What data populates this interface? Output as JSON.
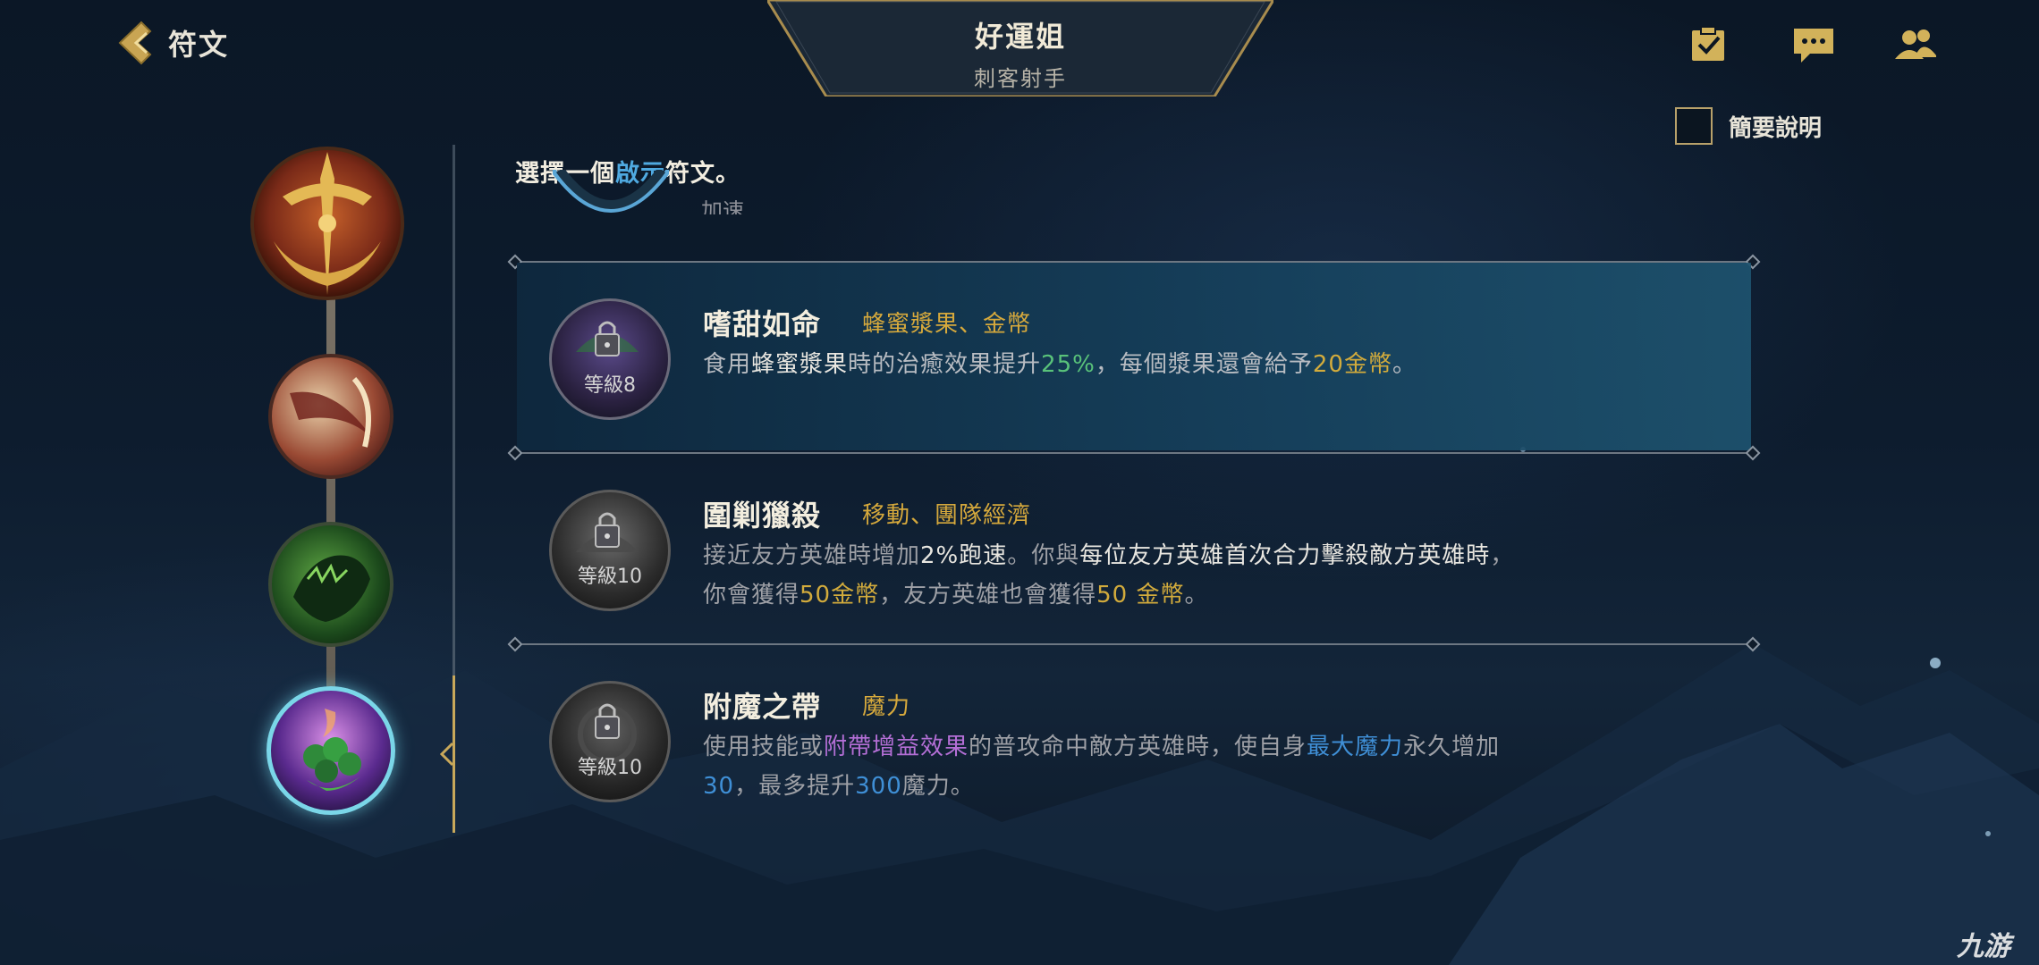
{
  "header": {
    "back_label": "符文",
    "champion_name": "好運姐",
    "champion_role": "刺客射手"
  },
  "top_icons": [
    "quest-checklist-icon",
    "chat-icon",
    "friends-icon"
  ],
  "summary_toggle": {
    "label": "簡要說明",
    "checked": false
  },
  "instruction": {
    "prefix": "選擇一個",
    "highlight": "啟示",
    "suffix": "符文。"
  },
  "peek_item": {
    "text": "加速"
  },
  "runes": [
    {
      "name": "嗜甜如命",
      "tags": "蜂蜜漿果、金幣",
      "level": "等級8",
      "selected": true,
      "desc_parts": [
        {
          "t": "食用",
          "c": ""
        },
        {
          "t": "蜂蜜漿果",
          "c": "w"
        },
        {
          "t": "時的治癒效果提升",
          "c": ""
        },
        {
          "t": "25%",
          "c": "g"
        },
        {
          "t": "，每個漿果還會給予",
          "c": ""
        },
        {
          "t": "20金幣",
          "c": "y"
        },
        {
          "t": "。",
          "c": ""
        }
      ]
    },
    {
      "name": "圍剿獵殺",
      "tags": "移動、團隊經濟",
      "level": "等級10",
      "selected": false,
      "desc_parts": [
        {
          "t": "接近友方英雄時增加",
          "c": ""
        },
        {
          "t": "2%跑速",
          "c": "w"
        },
        {
          "t": "。你與",
          "c": ""
        },
        {
          "t": "每位友方英雄首次合力擊殺敵方英雄時",
          "c": "w"
        },
        {
          "t": "，\n你會獲得",
          "c": ""
        },
        {
          "t": "50金幣",
          "c": "y"
        },
        {
          "t": "，友方英雄也會獲得",
          "c": ""
        },
        {
          "t": "50 金幣",
          "c": "y"
        },
        {
          "t": "。",
          "c": ""
        }
      ]
    },
    {
      "name": "附魔之帶",
      "tags": "魔力",
      "level": "等級10",
      "selected": false,
      "desc_parts": [
        {
          "t": "使用技能或",
          "c": ""
        },
        {
          "t": "附帶增益效果",
          "c": "p"
        },
        {
          "t": "的普攻命中敵方英雄時，使自身",
          "c": ""
        },
        {
          "t": "最大魔力",
          "c": "b"
        },
        {
          "t": "永久增加\n",
          "c": ""
        },
        {
          "t": "30",
          "c": "b"
        },
        {
          "t": "，最多提升",
          "c": ""
        },
        {
          "t": "300",
          "c": "b"
        },
        {
          "t": "魔力",
          "c": ""
        },
        {
          "t": "。",
          "c": ""
        }
      ]
    }
  ],
  "watermark": "九游",
  "colors": {
    "gold": "#d2ab3c",
    "accent_blue": "#4fa9e0",
    "green": "#59c27a",
    "purple": "#b46fd6"
  }
}
